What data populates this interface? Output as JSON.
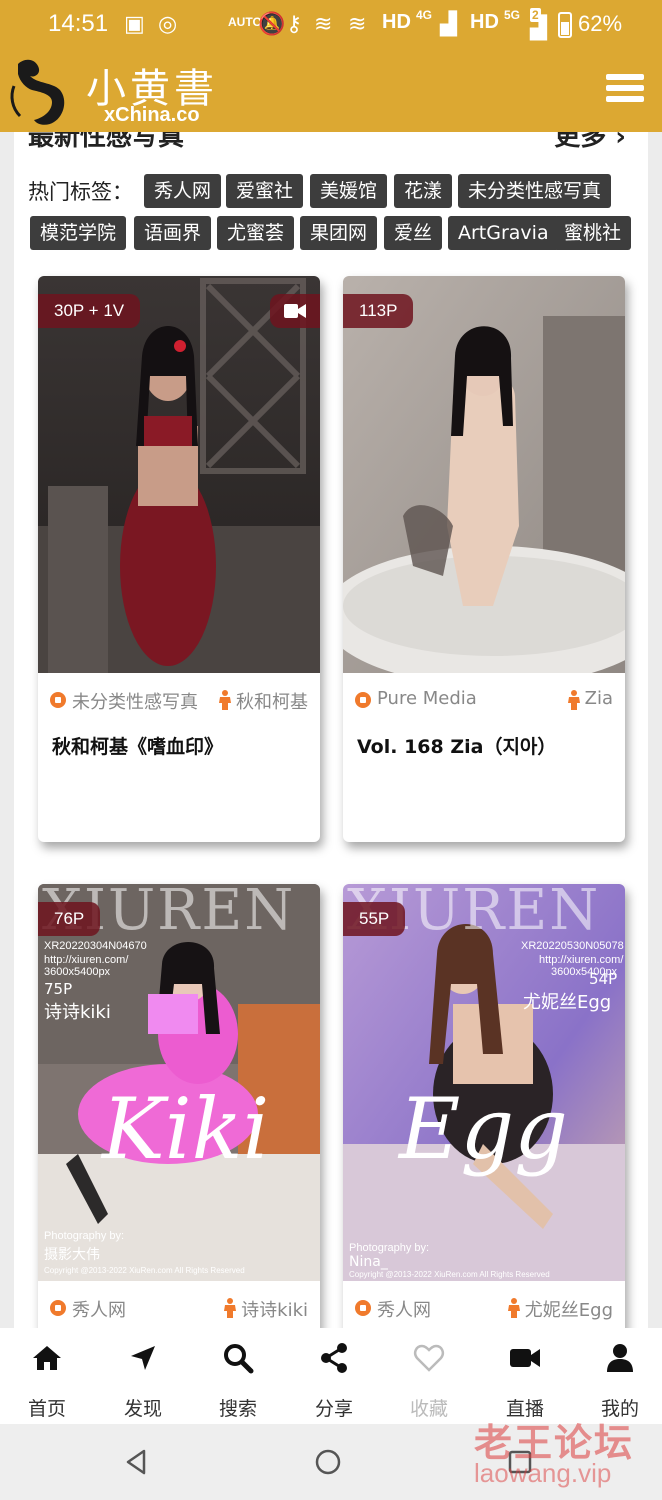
{
  "status_bar": {
    "time": "14:51",
    "auto_label": "AUTO",
    "hd1": "HD",
    "net1": "4G",
    "hd2": "HD",
    "net2": "5G",
    "sim_badge": "2",
    "battery": "62%"
  },
  "header": {
    "logo_cn": "小黄書",
    "logo_en": "xChina.co"
  },
  "section": {
    "title": "最新性感写真",
    "more": "更多 ›"
  },
  "tags": {
    "label": "热门标签：",
    "items": [
      "秀人网",
      "爱蜜社",
      "美媛馆",
      "花漾",
      "未分类性感写真",
      "模范学院",
      "语画界",
      "尤蜜荟",
      "果团网",
      "爱丝",
      "ArtGravia",
      "蜜桃社"
    ]
  },
  "cards": [
    {
      "badge": "30P + 1V",
      "has_video": true,
      "category": "未分类性感写真",
      "model": "秋和柯基",
      "title": "秋和柯基《嗜血印》"
    },
    {
      "badge": "113P",
      "has_video": false,
      "category": "Pure Media",
      "model": "Zia",
      "title": "Vol. 168 Zia（지아）"
    },
    {
      "badge": "76P",
      "has_video": false,
      "category": "秀人网",
      "model": "诗诗kiki",
      "title": "",
      "overlay": {
        "brand": "XIUREN",
        "code": "XR20220304N04670",
        "site": "http://xiuren.com/",
        "size": "3600x5400px",
        "count": "75P",
        "name": "诗诗kiki",
        "script": "Kiki",
        "photo_label": "Photography by:",
        "photographer": "摄影大伟",
        "copyright": "Copyright @2013-2022 XiuRen.com All Rights Reserved"
      }
    },
    {
      "badge": "55P",
      "has_video": false,
      "category": "秀人网",
      "model": "尤妮丝Egg",
      "title": "",
      "overlay": {
        "brand": "XIUREN",
        "code": "XR20220530N05078",
        "site": "http://xiuren.com/",
        "size": "3600x5400px",
        "count": "54P",
        "name": "尤妮丝Egg",
        "script": "Egg",
        "photo_label": "Photography by:",
        "photographer": "Nina_",
        "copyright": "Copyright @2013-2022 XiuRen.com All Rights Reserved"
      }
    }
  ],
  "bottom_nav": [
    {
      "label": "首页",
      "icon": "home-icon"
    },
    {
      "label": "发现",
      "icon": "location-arrow-icon"
    },
    {
      "label": "搜索",
      "icon": "search-icon"
    },
    {
      "label": "分享",
      "icon": "share-icon"
    },
    {
      "label": "收藏",
      "icon": "heart-icon"
    },
    {
      "label": "直播",
      "icon": "video-icon"
    },
    {
      "label": "我的",
      "icon": "user-icon"
    }
  ],
  "watermark": {
    "cn": "老王论坛",
    "en": "laowang.vip"
  },
  "colors": {
    "brand": "#dca832",
    "tag_bg": "#3d3d3d",
    "badge_bg": "#6e141e",
    "accent": "#f07a2c"
  }
}
